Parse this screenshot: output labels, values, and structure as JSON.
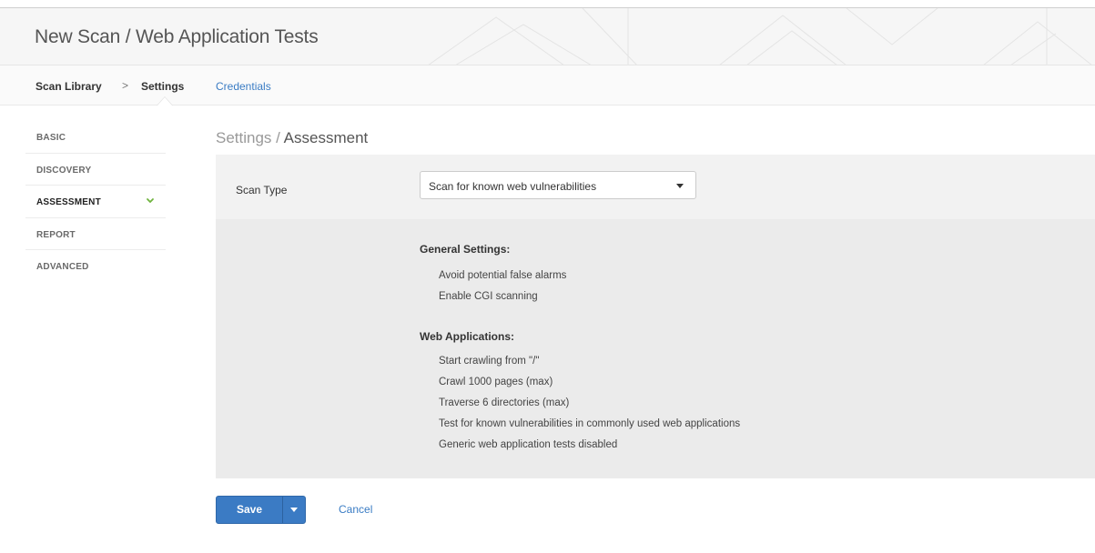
{
  "header": {
    "title": "New Scan / Web Application Tests"
  },
  "tabs": {
    "breadcrumb_root": "Scan Library",
    "breadcrumb_separator": ">",
    "breadcrumb_current": "Settings",
    "credentials_label": "Credentials"
  },
  "sidebar": {
    "items": [
      {
        "label": "BASIC"
      },
      {
        "label": "DISCOVERY"
      },
      {
        "label": "ASSESSMENT",
        "active": true
      },
      {
        "label": "REPORT"
      },
      {
        "label": "ADVANCED"
      }
    ]
  },
  "main": {
    "section_parent": "Settings /",
    "section_title": "Assessment",
    "scan_type_label": "Scan Type",
    "scan_type_value": "Scan for known web vulnerabilities",
    "groups": [
      {
        "title": "General Settings:",
        "lines": [
          "Avoid potential false alarms",
          "Enable CGI scanning"
        ]
      },
      {
        "title": "Web Applications:",
        "lines": [
          "Start crawling from \"/\"",
          "Crawl 1000 pages (max)",
          "Traverse 6 directories (max)",
          "Test for known vulnerabilities in commonly used web applications",
          "Generic web application tests disabled"
        ]
      }
    ]
  },
  "actions": {
    "save_label": "Save",
    "cancel_label": "Cancel"
  },
  "colors": {
    "accent": "#3b7bc4",
    "link": "#3a7cc4",
    "check": "#6fb33e"
  }
}
